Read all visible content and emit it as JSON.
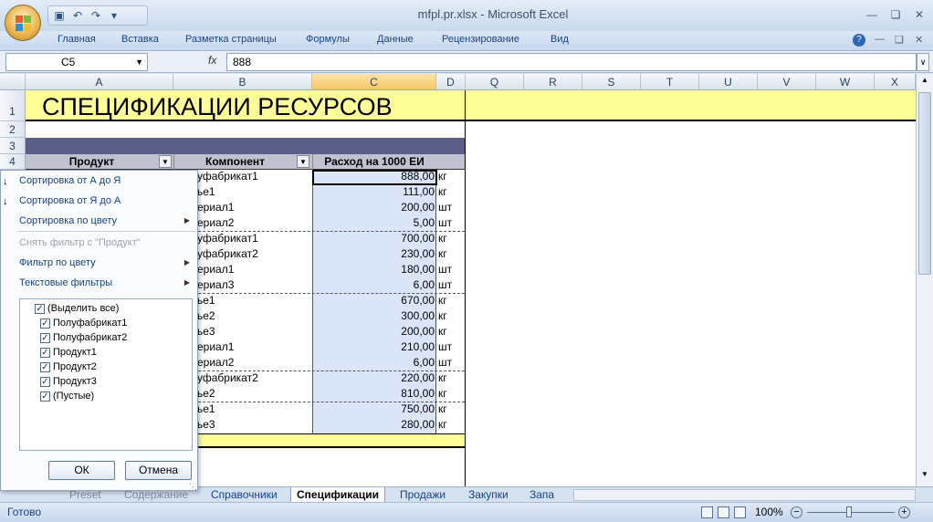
{
  "window": {
    "title": "mfpl.pr.xlsx - Microsoft Excel"
  },
  "ribbon": {
    "tabs": [
      "Главная",
      "Вставка",
      "Разметка страницы",
      "Формулы",
      "Данные",
      "Рецензирование",
      "Вид"
    ]
  },
  "formula_bar": {
    "name_box": "C5",
    "fx": "fx",
    "value": "888"
  },
  "columns": [
    "A",
    "B",
    "C",
    "D",
    "Q",
    "R",
    "S",
    "T",
    "U",
    "V",
    "W",
    "X"
  ],
  "rows": [
    "1",
    "2",
    "3",
    "4"
  ],
  "sheet": {
    "title": "СПЕЦИФИКАЦИИ РЕСУРСОВ",
    "headers": {
      "product": "Продукт",
      "component": "Компонент",
      "rate": "Расход на 1000 ЕИ"
    },
    "rows": [
      {
        "component": "уфабрикат1",
        "value": "888,00",
        "unit": "кг"
      },
      {
        "component": "ье1",
        "value": "111,00",
        "unit": "кг"
      },
      {
        "component": "ериал1",
        "value": "200,00",
        "unit": "шт"
      },
      {
        "component": "ериал2",
        "value": "5,00",
        "unit": "шт"
      },
      {
        "component": "уфабрикат1",
        "value": "700,00",
        "unit": "кг"
      },
      {
        "component": "уфабрикат2",
        "value": "230,00",
        "unit": "кг"
      },
      {
        "component": "ериал1",
        "value": "180,00",
        "unit": "шт"
      },
      {
        "component": "ериал3",
        "value": "6,00",
        "unit": "шт"
      },
      {
        "component": "ье1",
        "value": "670,00",
        "unit": "кг"
      },
      {
        "component": "ье2",
        "value": "300,00",
        "unit": "кг"
      },
      {
        "component": "ье3",
        "value": "200,00",
        "unit": "кг"
      },
      {
        "component": "ериал1",
        "value": "210,00",
        "unit": "шт"
      },
      {
        "component": "ериал2",
        "value": "6,00",
        "unit": "шт"
      },
      {
        "component": "уфабрикат2",
        "value": "220,00",
        "unit": "кг"
      },
      {
        "component": "ье2",
        "value": "810,00",
        "unit": "кг"
      },
      {
        "component": "ье1",
        "value": "750,00",
        "unit": "кг"
      },
      {
        "component": "ье3",
        "value": "280,00",
        "unit": "кг"
      }
    ]
  },
  "filter_menu": {
    "sort_az": "Сортировка от А до Я",
    "sort_za": "Сортировка от Я до А",
    "sort_color": "Сортировка по цвету",
    "clear_filter": "Снять фильтр с \"Продукт\"",
    "filter_color": "Фильтр по цвету",
    "text_filters": "Текстовые фильтры",
    "items": [
      "(Выделить все)",
      "Полуфабрикат1",
      "Полуфабрикат2",
      "Продукт1",
      "Продукт2",
      "Продукт3",
      "(Пустые)"
    ],
    "ok": "ОК",
    "cancel": "Отмена"
  },
  "sheet_tabs": [
    "Preset",
    "Содержание",
    "Справочники",
    "Спецификации",
    "Продажи",
    "Закупки",
    "Запа"
  ],
  "active_tab": "Спецификации",
  "status": {
    "ready": "Готово",
    "zoom": "100%"
  },
  "colors": {
    "header_band": "#5b5f88",
    "title_fill": "#ffff99",
    "col_fill": "#dbe5f9"
  }
}
